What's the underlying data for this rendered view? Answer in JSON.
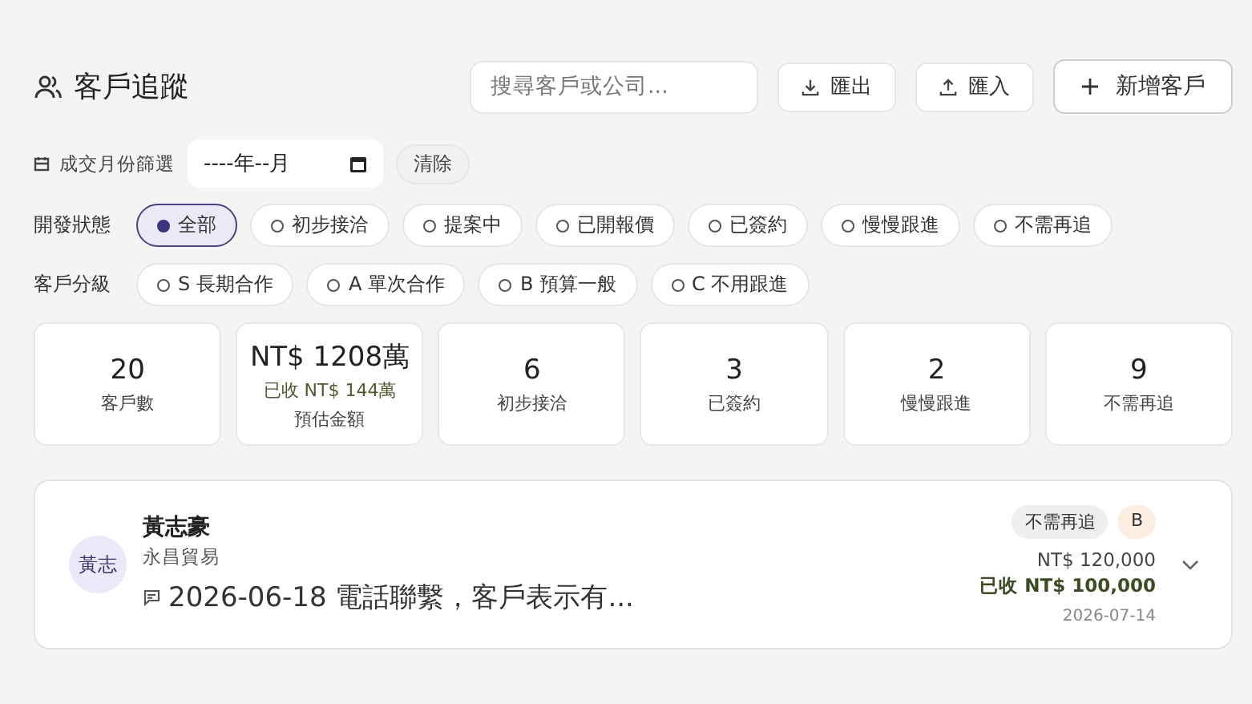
{
  "header": {
    "title": "客戶追蹤",
    "search": {
      "placeholder": "搜尋客戶或公司..."
    },
    "buttons": [
      {
        "kind": "export",
        "label": "匯出"
      },
      {
        "kind": "import",
        "label": "匯入"
      },
      {
        "kind": "add",
        "label": "新增客戶"
      }
    ]
  },
  "month_filter": {
    "label": "成交月份篩選",
    "value": "----年--月",
    "clear": "清除"
  },
  "status_filter": {
    "label": "開發狀態",
    "options": [
      {
        "label": "全部",
        "selected": true
      },
      {
        "label": "初步接洽",
        "selected": false
      },
      {
        "label": "提案中",
        "selected": false
      },
      {
        "label": "已開報價",
        "selected": false
      },
      {
        "label": "已簽約",
        "selected": false
      },
      {
        "label": "慢慢跟進",
        "selected": false
      },
      {
        "label": "不需再追",
        "selected": false
      }
    ]
  },
  "grade_filter": {
    "label": "客戶分級",
    "options": [
      {
        "label": "S 長期合作",
        "selected": false
      },
      {
        "label": "A 單次合作",
        "selected": false
      },
      {
        "label": "B 預算一般",
        "selected": false
      },
      {
        "label": "C 不用跟進",
        "selected": false
      }
    ]
  },
  "stats": [
    {
      "value": "20",
      "label": "客戶數"
    },
    {
      "value": "NT$ 1208萬",
      "sub": "已收 NT$ 144萬",
      "label": "預估金額"
    },
    {
      "value": "6",
      "label": "初步接洽"
    },
    {
      "value": "3",
      "label": "已簽約"
    },
    {
      "value": "2",
      "label": "慢慢跟進"
    },
    {
      "value": "9",
      "label": "不需再追"
    }
  ],
  "customers": [
    {
      "avatar": "黃志",
      "name": "黃志豪",
      "company": "永昌貿易",
      "note": "2026-06-18 電話聯繫，客戶表示有...",
      "status": "不需再追",
      "grade": "B",
      "color": "#fbeee0",
      "amount": "NT$ 120,000",
      "received": "已收 **NT$ 100,000**",
      "date": "2026-07-14",
      "expanded": false
    }
  ]
}
